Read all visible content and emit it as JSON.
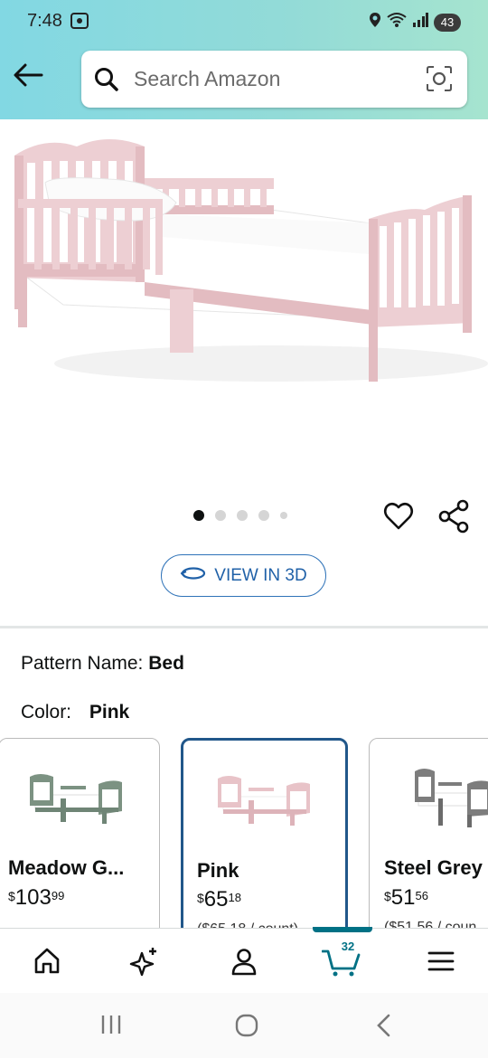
{
  "status_bar": {
    "time": "7:48",
    "battery": "43"
  },
  "search": {
    "placeholder": "Search Amazon"
  },
  "icons": {
    "back": "back-arrow-icon",
    "search": "search-icon",
    "camera": "camera-scan-icon",
    "heart": "heart-icon",
    "share": "share-icon",
    "rotate": "rotate-3d-icon",
    "home": "home-icon",
    "sparkle": "ai-sparkle-icon",
    "account": "account-icon",
    "cart": "cart-icon",
    "menu": "menu-icon"
  },
  "carousel": {
    "total": 5,
    "active_index": 0
  },
  "view3d": {
    "label": "VIEW IN 3D"
  },
  "pattern": {
    "label": "Pattern Name:",
    "value": "Bed"
  },
  "color": {
    "label": "Color:",
    "value": "Pink"
  },
  "variants": [
    {
      "name": "Meadow G...",
      "currency": "$",
      "whole": "103",
      "cents": "99",
      "unit": "",
      "bed_color": "#7c9282"
    },
    {
      "name": "Pink",
      "currency": "$",
      "whole": "65",
      "cents": "18",
      "unit": "($65.18 / count)",
      "bed_color": "#e8c3c8"
    },
    {
      "name": "Steel Grey",
      "currency": "$",
      "whole": "51",
      "cents": "56",
      "unit": "($51.56 / coun",
      "bed_color": "#7d7d7d"
    }
  ],
  "cart": {
    "count": "32"
  },
  "colors": {
    "accent_blue": "#21578a",
    "link_blue": "#2061a8",
    "cart_teal": "#007185",
    "bed_pink": "#edcfd3"
  }
}
